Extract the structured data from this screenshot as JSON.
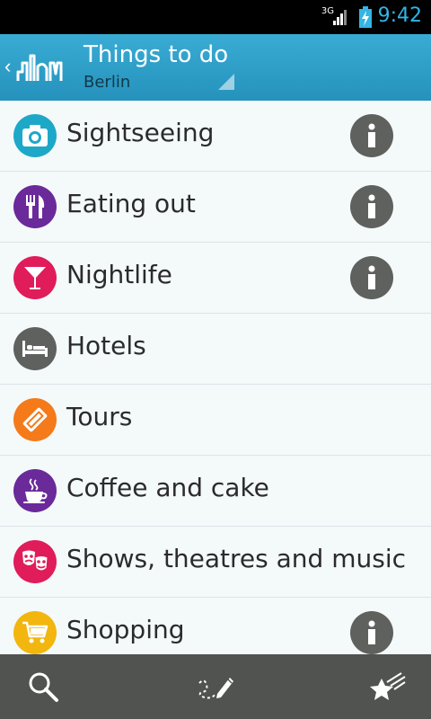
{
  "status_bar": {
    "network": "3G",
    "time": "9:42"
  },
  "action_bar": {
    "title": "Things to do",
    "subtitle": "Berlin"
  },
  "colors": {
    "action_bar": "#2a9bc4",
    "bottom_bar": "#515351",
    "info_button": "#5f615f"
  },
  "list": [
    {
      "label": "Sightseeing",
      "icon": "camera-icon",
      "color": "#1ea8c8",
      "info": true
    },
    {
      "label": "Eating out",
      "icon": "fork-knife-icon",
      "color": "#6a2a9a",
      "info": true
    },
    {
      "label": "Nightlife",
      "icon": "cocktail-icon",
      "color": "#e01c5a",
      "info": true
    },
    {
      "label": "Hotels",
      "icon": "bed-icon",
      "color": "#5f615f",
      "info": false
    },
    {
      "label": "Tours",
      "icon": "ticket-icon",
      "color": "#f47a1a",
      "info": false
    },
    {
      "label": "Coffee and cake",
      "icon": "coffee-cup-icon",
      "color": "#6a2a9a",
      "info": false
    },
    {
      "label": "Shows, theatres and music",
      "icon": "theatre-masks-icon",
      "color": "#e01c5a",
      "info": false
    },
    {
      "label": "Shopping",
      "icon": "shopping-cart-icon",
      "color": "#f2b60f",
      "info": true
    }
  ],
  "bottom_bar": {
    "buttons": [
      "search-icon",
      "route-pencil-icon",
      "favorites-stars-icon"
    ]
  }
}
